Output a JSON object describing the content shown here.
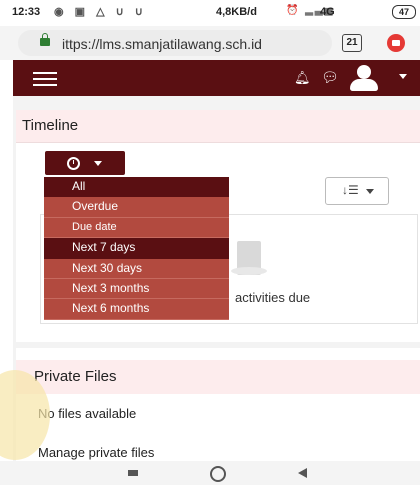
{
  "status_bar": {
    "time": "12:33",
    "network_speed": "4,8KB/d",
    "network_type": "4G",
    "battery": "47"
  },
  "browser": {
    "url": "ittps://lms.smanjatilawang.sch.id",
    "tab_count": "21"
  },
  "timeline": {
    "title": "Timeline",
    "dropdown_options": [
      "All",
      "Overdue",
      "Due date",
      "Next 7 days",
      "Next 30 days",
      "Next 3 months",
      "Next 6 months"
    ],
    "empty_text": "activities due"
  },
  "private_files": {
    "title": "Private Files",
    "empty_text": "No files available",
    "manage_link": "Manage private files"
  },
  "colors": {
    "brand": "#5a0f12",
    "dropdown": "#b24a3f"
  }
}
